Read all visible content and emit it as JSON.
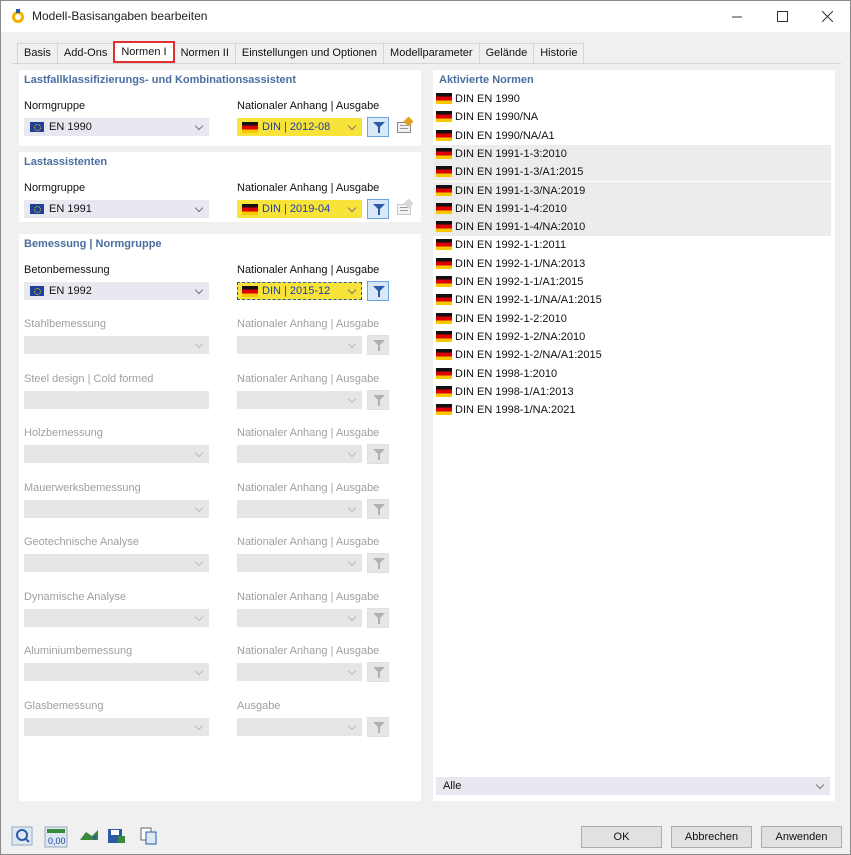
{
  "window": {
    "title": "Modell-Basisangaben bearbeiten"
  },
  "tabs": [
    "Basis",
    "Add-Ons",
    "Normen I",
    "Normen II",
    "Einstellungen und Optionen",
    "Modellparameter",
    "Gelände",
    "Historie"
  ],
  "active_tab": "Normen I",
  "lastfall": {
    "title": "Lastfallklassifizierungs- und Kombinationsassistent",
    "normgruppe_label": "Normgruppe",
    "normgruppe_value": "EN 1990",
    "anhang_label": "Nationaler Anhang | Ausgabe",
    "anhang_value": "DIN | 2012-08"
  },
  "lastassistenten": {
    "title": "Lastassistenten",
    "normgruppe_label": "Normgruppe",
    "normgruppe_value": "EN 1991",
    "anhang_label": "Nationaler Anhang | Ausgabe",
    "anhang_value": "DIN | 2019-04"
  },
  "bemessung": {
    "title": "Bemessung | Normgruppe",
    "beton_label": "Betonbemessung",
    "beton_value": "EN 1992",
    "beton_anhang_label": "Nationaler Anhang | Ausgabe",
    "beton_anhang_value": "DIN | 2015-12",
    "disabled_rows": [
      {
        "label": "Stahlbemessung",
        "anhang_label": "Nationaler Anhang | Ausgabe"
      },
      {
        "label": "Steel design | Cold formed",
        "anhang_label": "Nationaler Anhang | Ausgabe"
      },
      {
        "label": "Holzbemessung",
        "anhang_label": "Nationaler Anhang | Ausgabe"
      },
      {
        "label": "Mauerwerksbemessung",
        "anhang_label": "Nationaler Anhang | Ausgabe"
      },
      {
        "label": "Geotechnische Analyse",
        "anhang_label": "Nationaler Anhang | Ausgabe"
      },
      {
        "label": "Dynamische Analyse",
        "anhang_label": "Nationaler Anhang | Ausgabe"
      },
      {
        "label": "Aluminiumbemessung",
        "anhang_label": "Nationaler Anhang | Ausgabe"
      },
      {
        "label": "Glasbemessung",
        "anhang_label": "Ausgabe"
      }
    ]
  },
  "aktivierte_normen": {
    "title": "Aktivierte Normen",
    "items": [
      "DIN EN 1990",
      "DIN EN 1990/NA",
      "DIN EN 1990/NA/A1",
      "DIN EN 1991-1-3:2010",
      "DIN EN 1991-1-3/A1:2015",
      "DIN EN 1991-1-3/NA:2019",
      "DIN EN 1991-1-4:2010",
      "DIN EN 1991-1-4/NA:2010",
      "DIN EN 1992-1-1:2011",
      "DIN EN 1992-1-1/NA:2013",
      "DIN EN 1992-1-1/A1:2015",
      "DIN EN 1992-1-1/NA/A1:2015",
      "DIN EN 1992-1-2:2010",
      "DIN EN 1992-1-2/NA:2010",
      "DIN EN 1992-1-2/NA/A1:2015",
      "DIN EN 1998-1:2010",
      "DIN EN 1998-1/A1:2013",
      "DIN EN 1998-1/NA:2021"
    ],
    "filter_value": "Alle"
  },
  "buttons": {
    "ok": "OK",
    "cancel": "Abbrechen",
    "apply": "Anwenden"
  },
  "toolbar_icons": [
    "help-icon",
    "units-icon",
    "model-icon",
    "save-icon",
    "copy-icon"
  ],
  "toolbar_units_text": "0,00"
}
